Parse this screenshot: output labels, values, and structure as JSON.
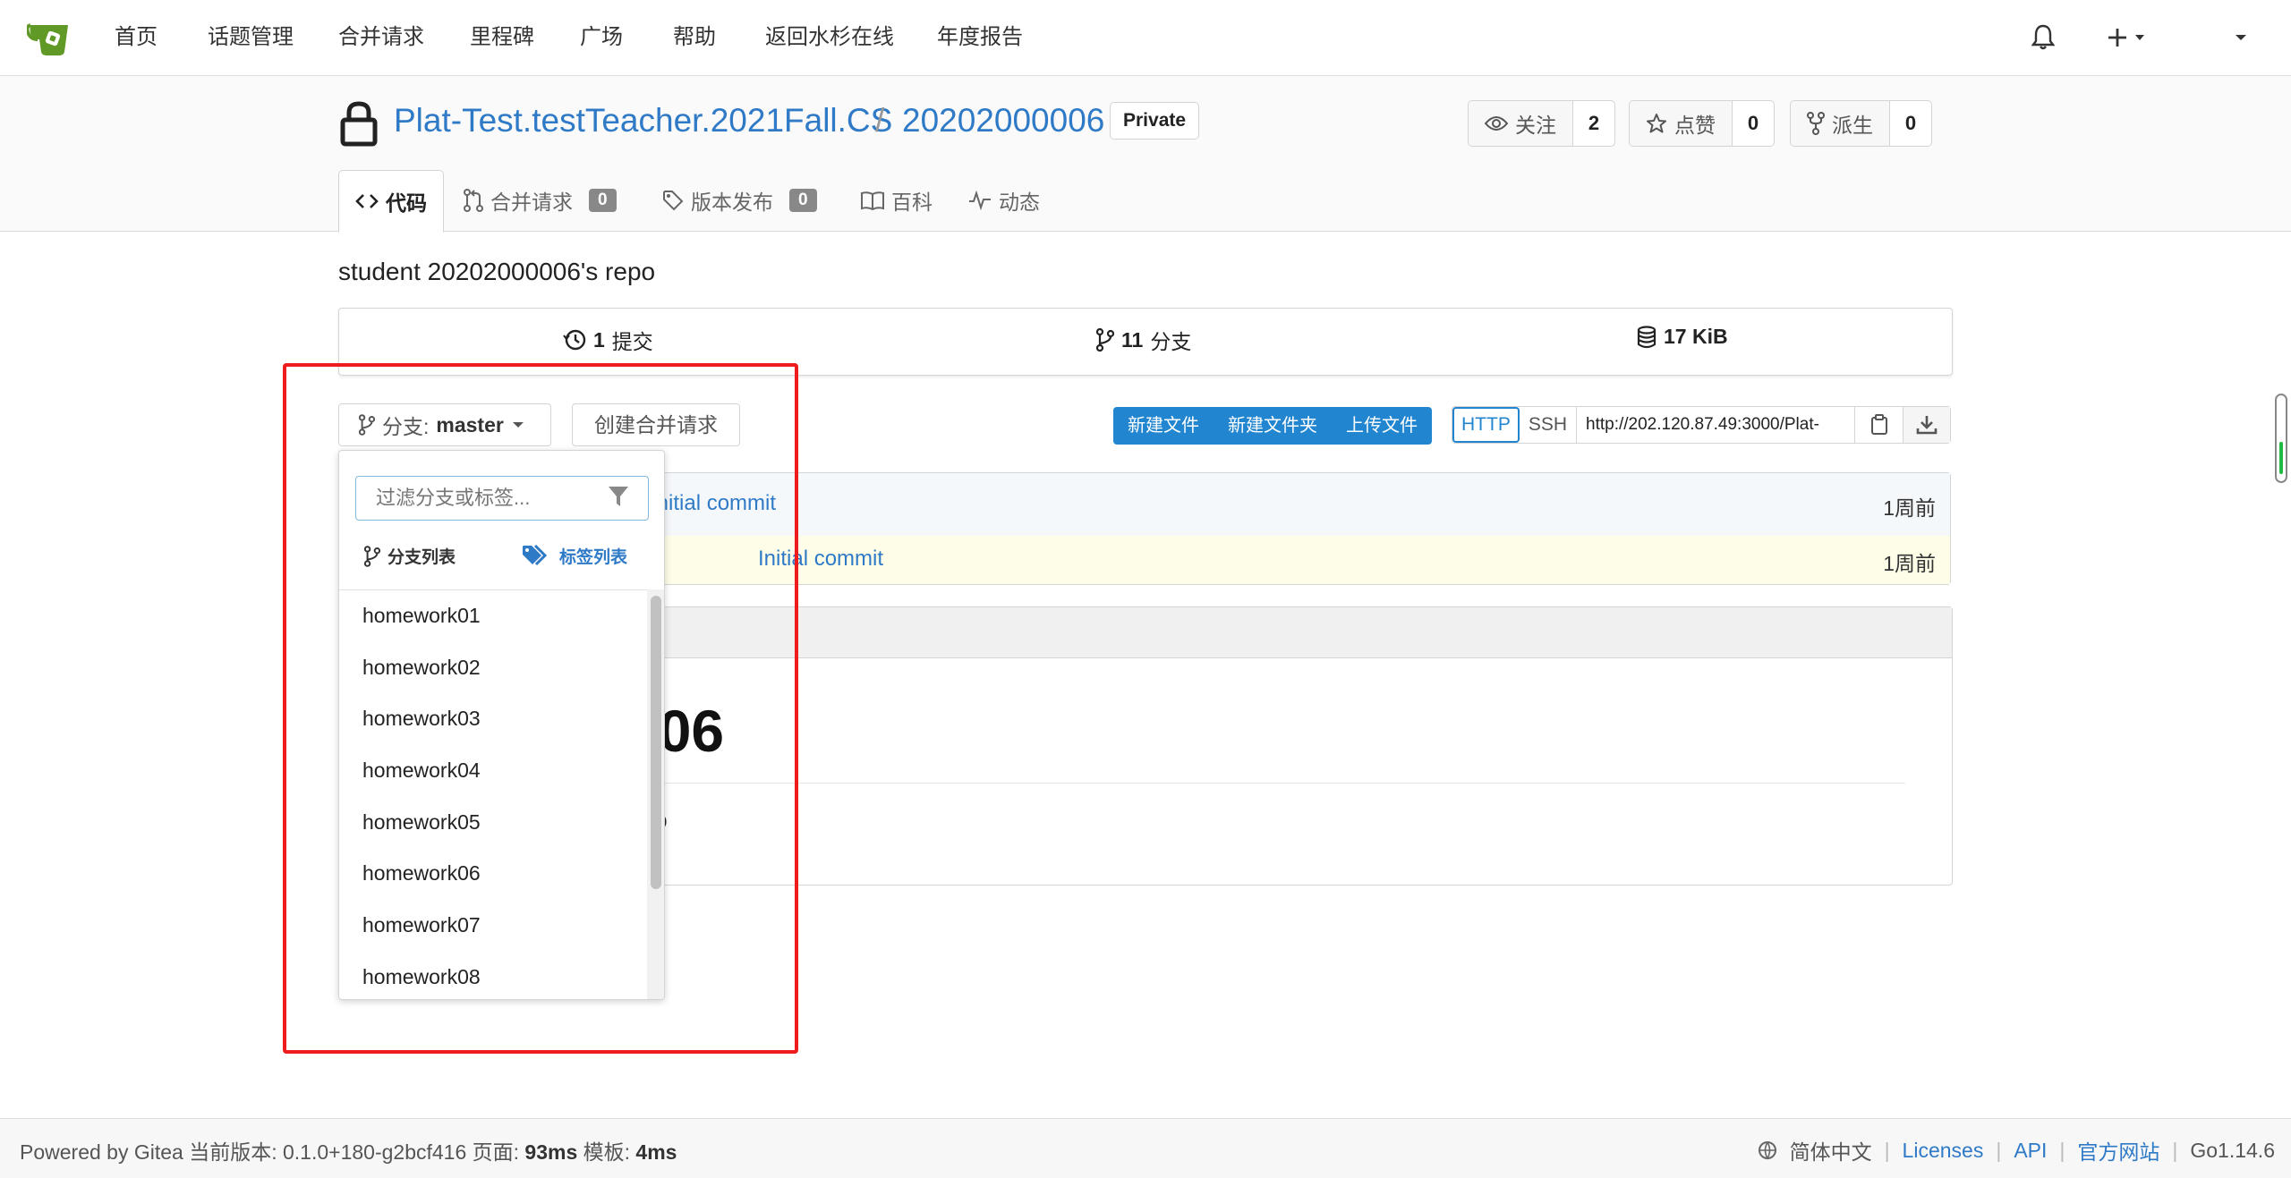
{
  "nav": {
    "items": [
      "首页",
      "话题管理",
      "合并请求",
      "里程碑",
      "广场",
      "帮助",
      "返回水杉在线",
      "年度报告"
    ]
  },
  "repo": {
    "owner": "Plat-Test.testTeacher.2021Fall.CS",
    "separator": "/",
    "name": "20202000006",
    "visibility": "Private",
    "watch_label": "关注",
    "watch_count": "2",
    "star_label": "点赞",
    "star_count": "0",
    "fork_label": "派生",
    "fork_count": "0"
  },
  "tabs": {
    "code": "代码",
    "pulls": "合并请求",
    "pulls_count": "0",
    "releases": "版本发布",
    "releases_count": "0",
    "wiki": "百科",
    "activity": "动态"
  },
  "description": "student 20202000006's repo",
  "stats": {
    "commits_num": "1",
    "commits_label": "提交",
    "branches_num": "11",
    "branches_label": "分支",
    "size": "17 KiB"
  },
  "toolbar": {
    "branch_prefix": "分支:",
    "branch_name": "master",
    "new_pr": "创建合并请求",
    "new_file": "新建文件",
    "new_folder": "新建文件夹",
    "upload_file": "上传文件",
    "http": "HTTP",
    "ssh": "SSH",
    "clone_url": "http://202.120.87.49:3000/Plat-"
  },
  "files": {
    "latest_commit": "Initial commit",
    "latest_ago": "1周前",
    "row_commit": "Initial commit",
    "row_ago": "1周前"
  },
  "readme": {
    "title_partial": "006",
    "text_partial": "epo"
  },
  "dropdown": {
    "filter_placeholder": "过滤分支或标签...",
    "branches_tab": "分支列表",
    "tags_tab": "标签列表",
    "items": [
      "homework01",
      "homework02",
      "homework03",
      "homework04",
      "homework05",
      "homework06",
      "homework07",
      "homework08"
    ]
  },
  "footer": {
    "powered": "Powered by Gitea 当前版本: 0.1.0+180-g2bcf416 页面:",
    "page_time": "93ms",
    "template_label": "模板:",
    "template_time": "4ms",
    "language": "简体中文",
    "licenses": "Licenses",
    "api": "API",
    "website": "官方网站",
    "go_version": "Go1.14.6"
  },
  "colors": {
    "link": "#2f7ac7",
    "primary": "#2185d0",
    "highlight": "#ee1c1c",
    "logo": "#609926"
  }
}
